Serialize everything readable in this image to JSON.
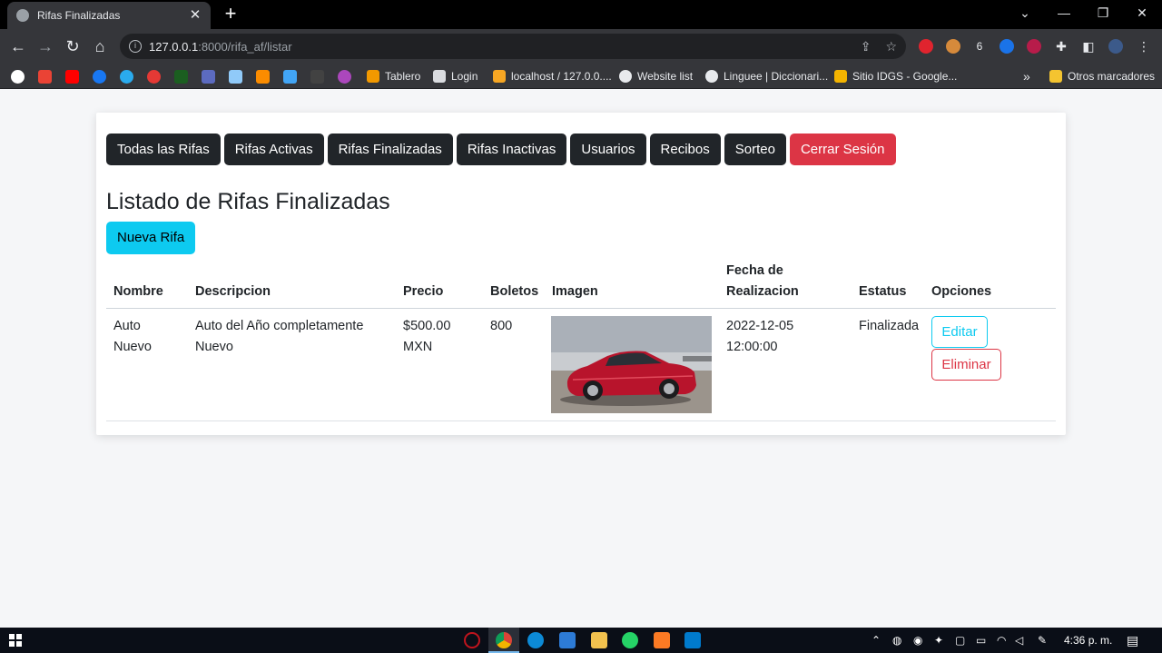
{
  "browser": {
    "tab_title": "Rifas Finalizadas",
    "tab_close": "✕",
    "new_tab": "+",
    "url_host": "127.0.0.1",
    "url_path": ":8000/rifa_af/listar",
    "bookmarks": [
      {
        "label": "Tablero",
        "color": "#f29900"
      },
      {
        "label": "Login",
        "color": "#dadce0"
      },
      {
        "label": "localhost / 127.0.0....",
        "color": "#f6a623"
      },
      {
        "label": "Website list",
        "color": "#e8eaed"
      },
      {
        "label": "Linguee | Diccionari...",
        "color": "#e8eaed"
      },
      {
        "label": "Sitio IDGS - Google...",
        "color": "#f4b400"
      }
    ],
    "more_bookmarks": "»",
    "other_bookmarks": "Otros marcadores"
  },
  "nav": {
    "items": [
      "Todas las Rifas",
      "Rifas Activas",
      "Rifas Finalizadas",
      "Rifas Inactivas",
      "Usuarios",
      "Recibos",
      "Sorteo"
    ],
    "logout": "Cerrar Sesión"
  },
  "page": {
    "title": "Listado de Rifas Finalizadas",
    "new_button": "Nueva Rifa"
  },
  "table": {
    "headers": {
      "nombre": "Nombre",
      "descripcion": "Descripcion",
      "precio": "Precio",
      "boletos": "Boletos",
      "imagen": "Imagen",
      "fecha_1": "Fecha de",
      "fecha_2": "Realizacion",
      "estatus": "Estatus",
      "opciones": "Opciones"
    },
    "rows": [
      {
        "nombre_1": "Auto",
        "nombre_2": "Nuevo",
        "descripcion_1": "Auto del Año completamente",
        "descripcion_2": "Nuevo",
        "precio_1": "$500.00",
        "precio_2": "MXN",
        "boletos": "800",
        "fecha_1": "2022-12-05",
        "fecha_2": "12:00:00",
        "estatus": "Finalizada",
        "edit_label": "Editar",
        "delete_label": "Eliminar"
      }
    ]
  },
  "taskbar": {
    "time": "4:36 p. m."
  },
  "colors": {
    "dark_button": "#212529",
    "danger": "#dc3545",
    "info": "#0dcaf0"
  }
}
